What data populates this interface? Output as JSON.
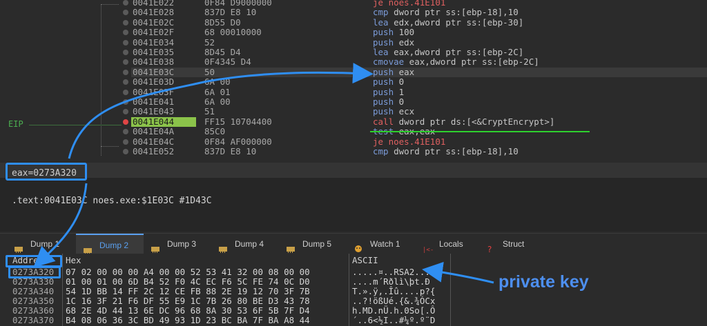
{
  "disasm": {
    "eip_label": "EIP",
    "rows": [
      {
        "addr": "0041E022",
        "bytes": "0F84 D9000000",
        "mn": "je",
        "ops": " noes.41E101",
        "kind": "jmp"
      },
      {
        "addr": "0041E028",
        "bytes": "837D E8 10",
        "mn": "cmp",
        "ops": " dword ptr ss:[ebp-18],10",
        "kind": "mn"
      },
      {
        "addr": "0041E02C",
        "bytes": "8D55 D0",
        "mn": "lea",
        "ops": " edx,dword ptr ss:[ebp-30]",
        "kind": "mn"
      },
      {
        "addr": "0041E02F",
        "bytes": "68 00010000",
        "mn": "push",
        "ops": " 100",
        "kind": "mn"
      },
      {
        "addr": "0041E034",
        "bytes": "52",
        "mn": "push",
        "ops": " edx",
        "kind": "mn"
      },
      {
        "addr": "0041E035",
        "bytes": "8D45 D4",
        "mn": "lea",
        "ops": " eax,dword ptr ss:[ebp-2C]",
        "kind": "mn"
      },
      {
        "addr": "0041E038",
        "bytes": "0F4345 D4",
        "mn": "cmovae",
        "ops": " eax,dword ptr ss:[ebp-2C]",
        "kind": "mn"
      },
      {
        "addr": "0041E03C",
        "bytes": "50",
        "mn": "push",
        "ops": " eax",
        "kind": "mn"
      },
      {
        "addr": "0041E03D",
        "bytes": "6A 00",
        "mn": "push",
        "ops": " 0",
        "kind": "mn"
      },
      {
        "addr": "0041E03F",
        "bytes": "6A 01",
        "mn": "push",
        "ops": " 1",
        "kind": "mn"
      },
      {
        "addr": "0041E041",
        "bytes": "6A 00",
        "mn": "push",
        "ops": " 0",
        "kind": "mn"
      },
      {
        "addr": "0041E043",
        "bytes": "51",
        "mn": "push",
        "ops": " ecx",
        "kind": "mn"
      },
      {
        "addr": "0041E044",
        "bytes": "FF15 10704400",
        "mn": "call",
        "ops": " dword ptr ds:[<&CryptEncrypt>]",
        "kind": "call"
      },
      {
        "addr": "0041E04A",
        "bytes": "85C0",
        "mn": "test",
        "ops": " eax,eax",
        "kind": "mn"
      },
      {
        "addr": "0041E04C",
        "bytes": "0F84 AF000000",
        "mn": "je",
        "ops": " noes.41E101",
        "kind": "jmp"
      },
      {
        "addr": "0041E052",
        "bytes": "837D E8 10",
        "mn": "cmp",
        "ops": " dword ptr ss:[ebp-18],10",
        "kind": "mn"
      }
    ]
  },
  "info": {
    "eax_value": "eax=0273A320",
    "location": ".text:0041E03C noes.exe:$1E03C #1D43C"
  },
  "tabs": [
    {
      "label": "Dump 1",
      "icon": "memory-icon",
      "active": false
    },
    {
      "label": "Dump 2",
      "icon": "memory-icon",
      "active": true
    },
    {
      "label": "Dump 3",
      "icon": "memory-icon",
      "active": false
    },
    {
      "label": "Dump 4",
      "icon": "memory-icon",
      "active": false
    },
    {
      "label": "Dump 5",
      "icon": "memory-icon",
      "active": false
    },
    {
      "label": "Watch 1",
      "icon": "watch-icon",
      "active": false
    },
    {
      "label": "Locals",
      "icon": "locals-icon",
      "active": false
    },
    {
      "label": "Struct",
      "icon": "struct-icon",
      "active": false
    }
  ],
  "dump": {
    "headers": {
      "address": "Address",
      "hex": "Hex",
      "ascii": "ASCII"
    },
    "rows": [
      {
        "addr": "0273A320",
        "hex": "07 02 00 00 00 A4 00 00 52 53 41 32 00 08 00 00",
        "ascii": ".....¤..RSA2...."
      },
      {
        "addr": "0273A330",
        "hex": "01 00 01 00 6D B4 52 F0 4C EC F6 5C FE 74 0C D0",
        "ascii": "....m´Rðlì\\þt.Ð"
      },
      {
        "addr": "0273A340",
        "hex": "54 1D BB 14 FF 2C 12 CE FB 88 2E 19 12 70 3F 7B",
        "ascii": "T.».ÿ,.Îû....p?{"
      },
      {
        "addr": "0273A350",
        "hex": "1C 16 3F 21 F6 DF 55 E9 1C 7B 26 80 BE D3 43 78",
        "ascii": "..?!ößUé.{&.¾ÓCx"
      },
      {
        "addr": "0273A360",
        "hex": "68 2E 4D 44 13 6E DC 96 68 8A 30 53 6F 5B 7F D4",
        "ascii": "h.MD.nÜ.h.0So[.Ô"
      },
      {
        "addr": "0273A370",
        "hex": "B4 08 06 36 3C BD 49 93 1D 23 BC BA 7F BA A8 44",
        "ascii": "´..6<½I..#¼º.º¨D"
      }
    ]
  },
  "annotation": {
    "label": "private key",
    "color": "#2f8ef2"
  }
}
